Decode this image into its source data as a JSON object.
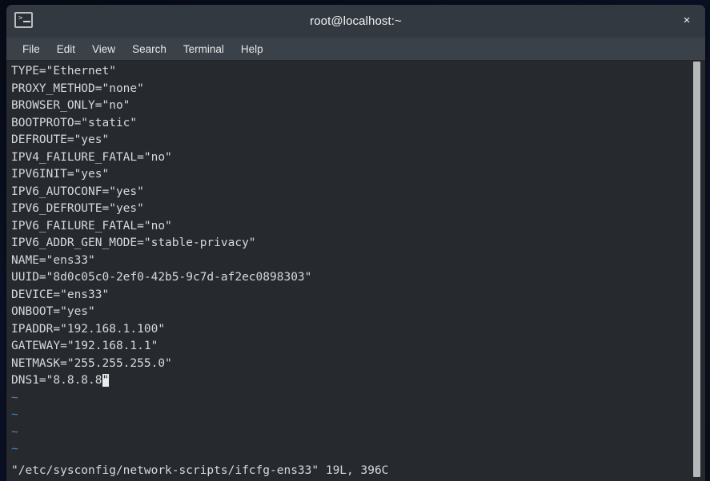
{
  "window": {
    "title": "root@localhost:~",
    "icon": "terminal-icon",
    "close_label": "×"
  },
  "menubar": {
    "items": [
      {
        "label": "File"
      },
      {
        "label": "Edit"
      },
      {
        "label": "View"
      },
      {
        "label": "Search"
      },
      {
        "label": "Terminal"
      },
      {
        "label": "Help"
      }
    ]
  },
  "editor": {
    "lines": [
      "TYPE=\"Ethernet\"",
      "PROXY_METHOD=\"none\"",
      "BROWSER_ONLY=\"no\"",
      "BOOTPROTO=\"static\"",
      "DEFROUTE=\"yes\"",
      "IPV4_FAILURE_FATAL=\"no\"",
      "IPV6INIT=\"yes\"",
      "IPV6_AUTOCONF=\"yes\"",
      "IPV6_DEFROUTE=\"yes\"",
      "IPV6_FAILURE_FATAL=\"no\"",
      "IPV6_ADDR_GEN_MODE=\"stable-privacy\"",
      "NAME=\"ens33\"",
      "UUID=\"8d0c05c0-2ef0-42b5-9c7d-af2ec0898303\"",
      "DEVICE=\"ens33\"",
      "ONBOOT=\"yes\"",
      "IPADDR=\"192.168.1.100\"",
      "GATEWAY=\"192.168.1.1\"",
      "NETMASK=\"255.255.255.0\""
    ],
    "cursor_line": {
      "before": "DNS1=\"8.8.8.8",
      "cursor_char": "\"",
      "after": ""
    },
    "empty_markers": [
      "~",
      "~",
      "~",
      "~"
    ],
    "status": "\"/etc/sysconfig/network-scripts/ifcfg-ens33\" 19L, 396C"
  },
  "colors": {
    "terminal_background": "#26292e",
    "titlebar_background": "#333940",
    "menubar_background": "#3b4149",
    "text": "#d6d9dc",
    "tilde": "#5a7fae",
    "cursor": "#e9ebed",
    "scrollbar": "#b6b8ba"
  }
}
